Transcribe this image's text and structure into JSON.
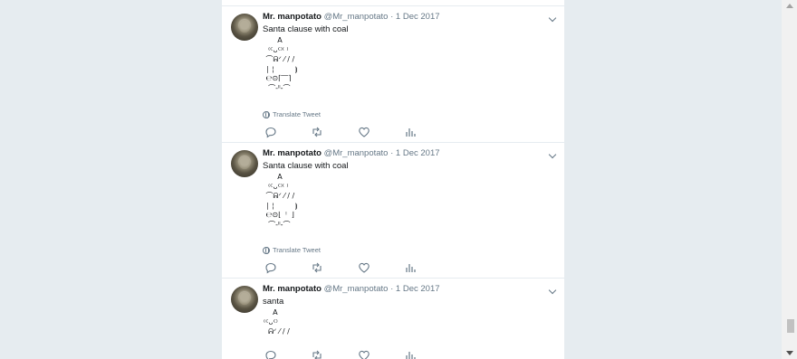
{
  "tweets": [
    {
      "name": "Mr. manpotato",
      "handle": "@Mr_manpotato",
      "date": "1 Dec 2017",
      "text": "Santa clause with coal",
      "art": "      A\n  ⁽ᑦᴗᑦ⁾⁽ ⁾\n ⌒ᕱᐟ ⁄ / /\n ∣ ¦         ⦘\n ℮⊙⌈‾‾⌉\n  ⌒-ˡˡ-⌒",
      "translate_label": "Translate Tweet"
    },
    {
      "name": "Mr. manpotato",
      "handle": "@Mr_manpotato",
      "date": "1 Dec 2017",
      "text": "Santa clause with coal",
      "art": "      A\n  ⁽ᑦᴗᑦ⁾⁽ ⁾\n ⌒ᕱᐟ ⁄ / /\n ∣ ¦         ⦘\n ℮⊙⌊  ˡ  ⌋\n  ⌒-ˡˡ-⌒",
      "translate_label": "Translate Tweet"
    },
    {
      "name": "Mr. manpotato",
      "handle": "@Mr_manpotato",
      "date": "1 Dec 2017",
      "text": "santa",
      "art": "    A\n⁽ᑦᴗᑦ⁾\n  ᕱᐟ ⁄ / /",
      "translate_label": ""
    }
  ],
  "colors": {
    "page_bg": "#e6ecf0",
    "card_bg": "#ffffff",
    "muted": "#657786",
    "text": "#14171a"
  }
}
